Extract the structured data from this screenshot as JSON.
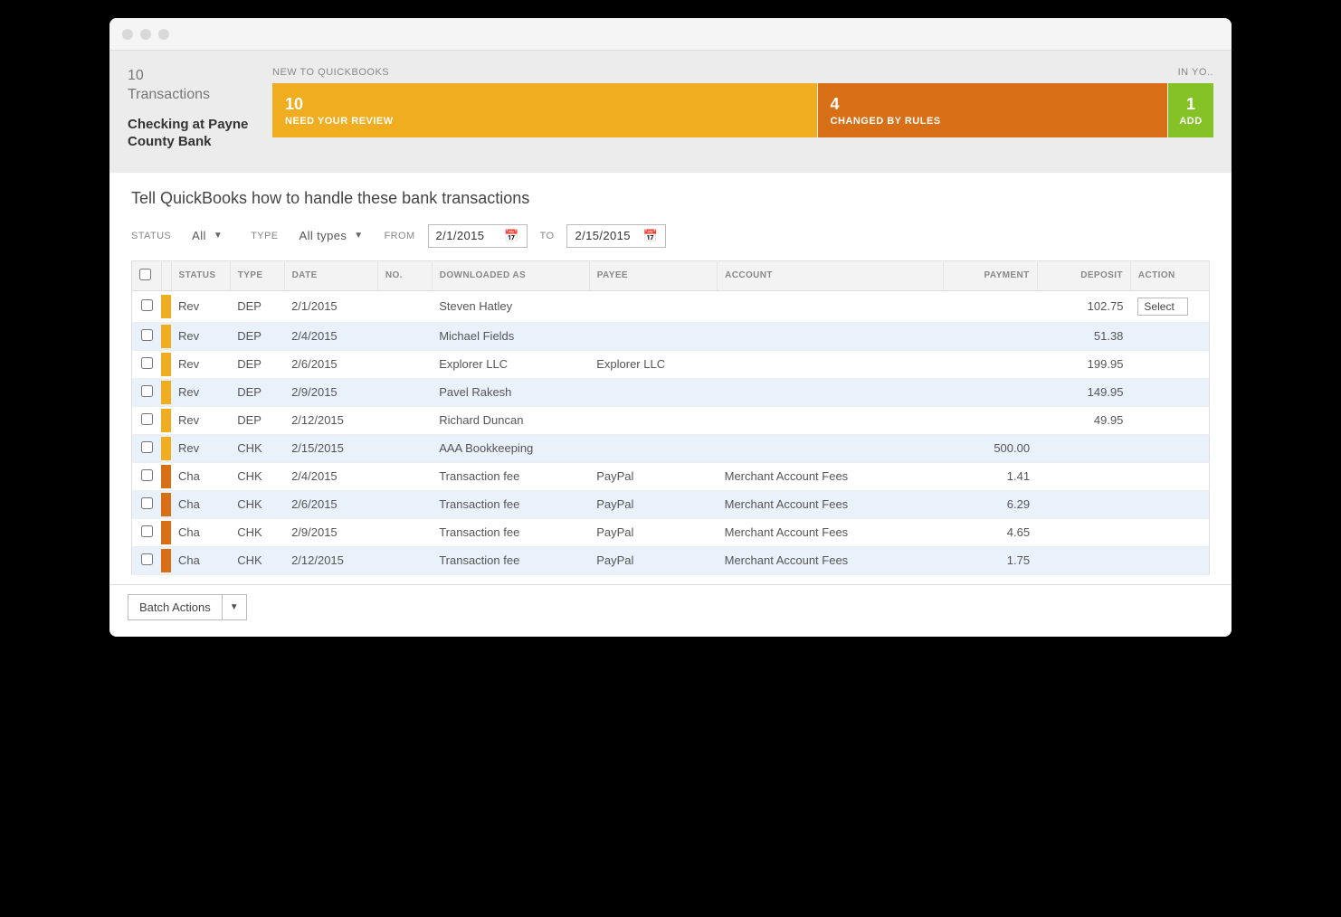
{
  "header": {
    "transactions_count": "10",
    "transactions_label": "Transactions",
    "bank_label": "Checking at Payne County Bank",
    "tab_group_new_label": "NEW TO QUICKBOOKS",
    "tab_group_inyo_label": "IN YO..",
    "tiles": {
      "review": {
        "count": "10",
        "label": "NEED YOUR REVIEW"
      },
      "changed": {
        "count": "4",
        "label": "CHANGED BY RULES"
      },
      "add": {
        "count": "1",
        "label": "ADD"
      }
    }
  },
  "content": {
    "title": "Tell QuickBooks how to handle these bank transactions",
    "filters": {
      "status_label": "STATUS",
      "status_value": "All",
      "type_label": "TYPE",
      "type_value": "All types",
      "from_label": "FROM",
      "from_value": "2/1/2015",
      "to_label": "TO",
      "to_value": "2/15/2015"
    },
    "columns": {
      "status": "STATUS",
      "type": "TYPE",
      "date": "DATE",
      "no": "NO.",
      "downloaded_as": "DOWNLOADED AS",
      "payee": "PAYEE",
      "account": "ACCOUNT",
      "payment": "PAYMENT",
      "deposit": "DEPOSIT",
      "action": "ACTION"
    },
    "rows": [
      {
        "flag": "orange",
        "status": "Rev",
        "type": "DEP",
        "date": "2/1/2015",
        "no": "",
        "downloaded_as": "Steven Hatley",
        "payee": "",
        "account": "",
        "payment": "",
        "deposit": "102.75",
        "action": "Select",
        "selected": true
      },
      {
        "flag": "orange",
        "status": "Rev",
        "type": "DEP",
        "date": "2/4/2015",
        "no": "",
        "downloaded_as": "Michael Fields",
        "payee": "",
        "account": "",
        "payment": "",
        "deposit": "51.38",
        "action": ""
      },
      {
        "flag": "orange",
        "status": "Rev",
        "type": "DEP",
        "date": "2/6/2015",
        "no": "",
        "downloaded_as": "Explorer LLC",
        "payee": "Explorer LLC",
        "account": "",
        "payment": "",
        "deposit": "199.95",
        "action": ""
      },
      {
        "flag": "orange",
        "status": "Rev",
        "type": "DEP",
        "date": "2/9/2015",
        "no": "",
        "downloaded_as": "Pavel Rakesh",
        "payee": "",
        "account": "",
        "payment": "",
        "deposit": "149.95",
        "action": ""
      },
      {
        "flag": "orange",
        "status": "Rev",
        "type": "DEP",
        "date": "2/12/2015",
        "no": "",
        "downloaded_as": "Richard Duncan",
        "payee": "",
        "account": "",
        "payment": "",
        "deposit": "49.95",
        "action": ""
      },
      {
        "flag": "orange",
        "status": "Rev",
        "type": "CHK",
        "date": "2/15/2015",
        "no": "",
        "downloaded_as": "AAA Bookkeeping",
        "payee": "",
        "account": "",
        "payment": "500.00",
        "deposit": "",
        "action": ""
      },
      {
        "flag": "dkorange",
        "status": "Cha",
        "type": "CHK",
        "date": "2/4/2015",
        "no": "",
        "downloaded_as": "Transaction fee",
        "payee": "PayPal",
        "account": "Merchant Account Fees",
        "payment": "1.41",
        "deposit": "",
        "action": ""
      },
      {
        "flag": "dkorange",
        "status": "Cha",
        "type": "CHK",
        "date": "2/6/2015",
        "no": "",
        "downloaded_as": "Transaction fee",
        "payee": "PayPal",
        "account": "Merchant Account Fees",
        "payment": "6.29",
        "deposit": "",
        "action": ""
      },
      {
        "flag": "dkorange",
        "status": "Cha",
        "type": "CHK",
        "date": "2/9/2015",
        "no": "",
        "downloaded_as": "Transaction fee",
        "payee": "PayPal",
        "account": "Merchant Account Fees",
        "payment": "4.65",
        "deposit": "",
        "action": ""
      },
      {
        "flag": "dkorange",
        "status": "Cha",
        "type": "CHK",
        "date": "2/12/2015",
        "no": "",
        "downloaded_as": "Transaction fee",
        "payee": "PayPal",
        "account": "Merchant Account Fees",
        "payment": "1.75",
        "deposit": "",
        "action": ""
      }
    ]
  },
  "footer": {
    "batch_label": "Batch Actions"
  }
}
